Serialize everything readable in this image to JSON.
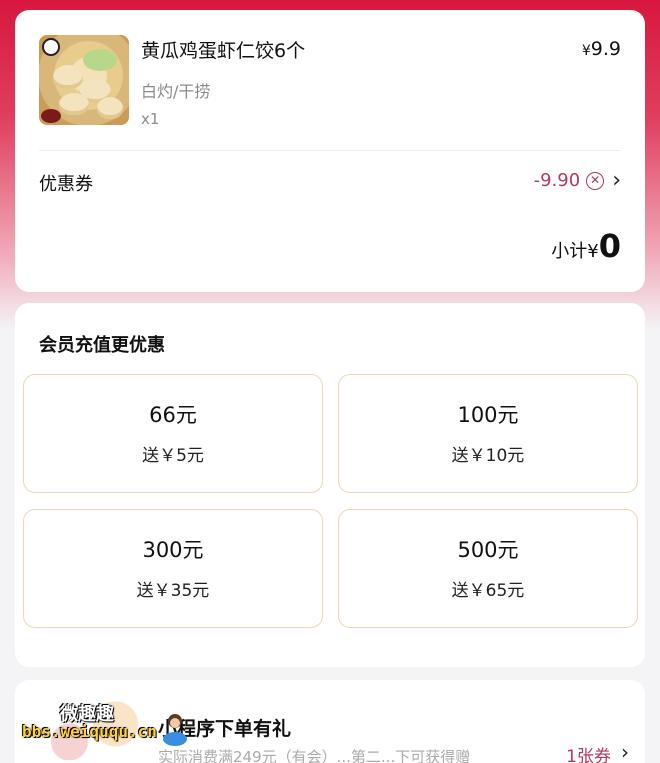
{
  "order": {
    "product_name": "黄瓜鸡蛋虾仁饺6个",
    "spec": "白灼/干捞",
    "quantity": "x1",
    "price_symbol": "¥",
    "price": "9.9",
    "coupon_label": "优惠券",
    "coupon_amount": "-9.90",
    "subtotal_label": "小计¥",
    "subtotal_value": "0"
  },
  "recharge": {
    "title": "会员充值更优惠",
    "options": [
      {
        "amount": "66元",
        "bonus": "送￥5元"
      },
      {
        "amount": "100元",
        "bonus": "送￥10元"
      },
      {
        "amount": "300元",
        "bonus": "送￥35元"
      },
      {
        "amount": "500元",
        "bonus": "送￥65元"
      }
    ]
  },
  "promo": {
    "title": "小程序下单有礼",
    "description": "实际消费满249元（有会）...第二...下可获得赠",
    "badge": "1张券"
  },
  "watermark": {
    "cn": "微趣趣",
    "url": "bbs.weiququ.cn"
  },
  "colors": {
    "header_red": "#d8173f",
    "discount_text": "#b03a5b",
    "option_border": "#ead9b3"
  },
  "icons": [
    "clear-circle-icon",
    "chevron-right-icon"
  ]
}
